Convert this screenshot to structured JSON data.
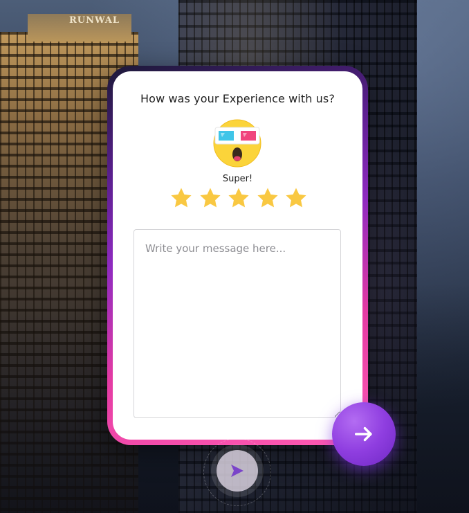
{
  "background": {
    "building_sign": "RUNWAL"
  },
  "feedback": {
    "question": "How was your Experience with us?",
    "emoji_icon": "3d-glasses-surprised-emoji-icon",
    "rating_label": "Super!",
    "rating": 5,
    "max_rating": 5,
    "star_color": "#f9c842",
    "message_placeholder": "Write your message here...",
    "message_value": ""
  },
  "actions": {
    "next_icon": "arrow-right-icon",
    "send_icon": "send-icon"
  },
  "colors": {
    "frame_gradient": [
      "#1c1938",
      "#8f2ac0",
      "#ff5bb2"
    ],
    "button_purple": "#8f3ee0"
  }
}
